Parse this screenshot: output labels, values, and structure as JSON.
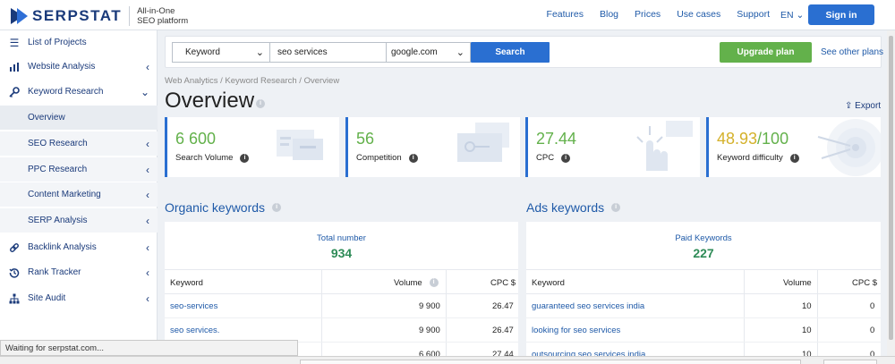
{
  "header": {
    "brand": "SERPSTAT",
    "tagline_line1": "All-in-One",
    "tagline_line2": "SEO platform",
    "nav": [
      "Features",
      "Blog",
      "Prices",
      "Use cases",
      "Support"
    ],
    "language": "EN",
    "signin_label": "Sign in"
  },
  "sidebar": {
    "items": [
      {
        "label": "List of Projects",
        "icon": "menu-icon"
      },
      {
        "label": "Website Analysis",
        "icon": "bar-chart-icon"
      },
      {
        "label": "Keyword Research",
        "icon": "key-icon"
      },
      {
        "label": "Overview"
      },
      {
        "label": "SEO Research"
      },
      {
        "label": "PPC Research"
      },
      {
        "label": "Content Marketing"
      },
      {
        "label": "SERP Analysis"
      },
      {
        "label": "Backlink Analysis",
        "icon": "link-icon"
      },
      {
        "label": "Rank Tracker",
        "icon": "history-icon"
      },
      {
        "label": "Site Audit",
        "icon": "sitemap-icon"
      }
    ]
  },
  "search": {
    "type_value": "Keyword",
    "query_value": "seo services",
    "engine_value": "google.com",
    "search_label": "Search",
    "upgrade_label": "Upgrade plan",
    "other_plans_label": "See other plans"
  },
  "breadcrumb": "Web Analytics / Keyword Research / Overview",
  "page_title": "Overview",
  "export_label": "Export",
  "metrics": [
    {
      "value": "6 600",
      "label": "Search Volume"
    },
    {
      "value": "56",
      "label": "Competition"
    },
    {
      "value": "27.44",
      "label": "CPC"
    },
    {
      "value_main": "48.93",
      "value_max": "/100",
      "label": "Keyword difficulty"
    }
  ],
  "organic": {
    "title": "Organic keywords",
    "total_label": "Total number",
    "total_value": "934",
    "columns": [
      "Keyword",
      "Volume",
      "CPC $"
    ],
    "rows": [
      {
        "keyword": "seo-services",
        "volume": "9 900",
        "cpc": "26.47"
      },
      {
        "keyword": "seo services.",
        "volume": "9 900",
        "cpc": "26.47"
      },
      {
        "keyword": "",
        "volume": "6 600",
        "cpc": "27.44"
      }
    ]
  },
  "ads": {
    "title": "Ads keywords",
    "total_label": "Paid Keywords",
    "total_value": "227",
    "columns": [
      "Keyword",
      "Volume",
      "CPC $"
    ],
    "rows": [
      {
        "keyword": "guaranteed seo services india",
        "volume": "10",
        "cpc": "0"
      },
      {
        "keyword": "looking for seo services",
        "volume": "10",
        "cpc": "0"
      },
      {
        "keyword": "outsourcing seo services india",
        "volume": "10",
        "cpc": "0"
      }
    ]
  },
  "status_text": "Waiting for serpstat.com...",
  "colors": {
    "accent": "#2a6fd1",
    "green": "#63b14b",
    "brand": "#1a3a7a",
    "difficulty": "#d4b12a"
  }
}
